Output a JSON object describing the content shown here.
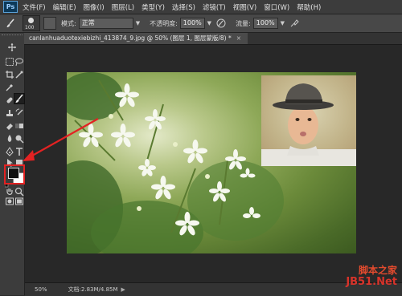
{
  "menubar": {
    "app_logo": "Ps",
    "items": [
      "文件(F)",
      "编辑(E)",
      "图像(I)",
      "图层(L)",
      "类型(Y)",
      "选择(S)",
      "滤镜(T)",
      "视图(V)",
      "窗口(W)",
      "帮助(H)"
    ]
  },
  "options": {
    "brush_size": "100",
    "mode_label": "模式:",
    "mode_value": "正常",
    "opacity_label": "不透明度:",
    "opacity_value": "100%",
    "flow_label": "流量:",
    "flow_value": "100%"
  },
  "document": {
    "tab_title": "canlanhuaduotexiebizhi_413874_9.jpg @ 50% (图层 1, 图层蒙版/8) *",
    "close_glyph": "×"
  },
  "status": {
    "zoom": "50%",
    "doc_info": "文档:2.83M/4.85M"
  },
  "watermark": {
    "line1": "脚本之家",
    "line2": "JB51.Net"
  },
  "colors": {
    "foreground": "#101010",
    "background": "#ffffff",
    "highlight": "#e32222"
  },
  "icons": [
    "move-icon",
    "marquee-icon",
    "lasso-icon",
    "quick-select-icon",
    "crop-icon",
    "eyedropper-icon",
    "healing-icon",
    "brush-icon",
    "stamp-icon",
    "history-brush-icon",
    "eraser-icon",
    "gradient-icon",
    "blur-icon",
    "dodge-icon",
    "pen-icon",
    "type-icon",
    "path-select-icon",
    "shape-icon",
    "hand-icon",
    "zoom-icon",
    "swap-colors-icon",
    "default-colors-icon",
    "quick-mask-icon",
    "screen-mode-icon"
  ]
}
